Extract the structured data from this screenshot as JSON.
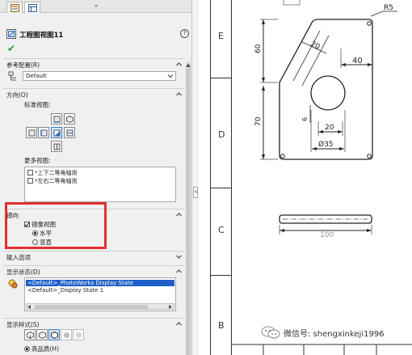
{
  "panel": {
    "tabs": [
      "property-manager",
      "config-manager"
    ],
    "title": "工程图视图11",
    "help": "?",
    "ok": "✔",
    "reference_config": {
      "header": "参考配置(R)",
      "value": "Default"
    },
    "orientation": {
      "header": "方向(O)",
      "standard_views_label": "标准视图:",
      "more_views_label": "更多视图:",
      "more_views_items": [
        "*上下二等角轴测",
        "*左右二等角轴测"
      ]
    },
    "mirror": {
      "header": "镜向",
      "checkbox_label": "镜像视图",
      "checked": true,
      "options": [
        {
          "label": "水平",
          "selected": true
        },
        {
          "label": "竖直",
          "selected": false
        }
      ]
    },
    "import_options": {
      "header": "输入选项"
    },
    "display_state": {
      "header": "显示状态(D)",
      "items": [
        {
          "label": "<Default>_PhotoWorks Display State",
          "selected": true
        },
        {
          "label": "<Default>_Display State 1",
          "selected": false
        }
      ]
    },
    "display_style": {
      "header": "显示样式(S)",
      "quality_label": "高品质(H)"
    }
  },
  "sheet": {
    "zones": [
      "E",
      "D",
      "C",
      "B"
    ],
    "dims": {
      "r5": "R5",
      "d40": "40",
      "d60": "60",
      "d20_angle": "20",
      "d70": "70",
      "d6": "6",
      "d20_bottom": "20",
      "dia35": "Ø35",
      "d100": "100"
    }
  },
  "watermark": {
    "text": "微信号: shengxinkeji1996"
  }
}
